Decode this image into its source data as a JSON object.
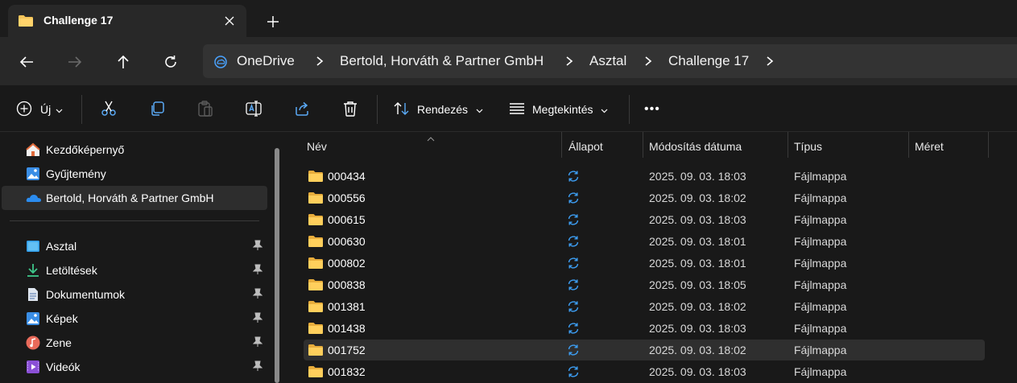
{
  "tab": {
    "title": "Challenge 17"
  },
  "breadcrumb": [
    "OneDrive",
    "Bertold, Horváth & Partner GmbH",
    "Asztal",
    "Challenge 17"
  ],
  "toolbar": {
    "new_label": "Új",
    "sort_label": "Rendezés",
    "view_label": "Megtekintés",
    "more_label": "•••"
  },
  "sidebar": {
    "top": [
      {
        "label": "Kezdőképernyő",
        "icon": "home-icon"
      },
      {
        "label": "Gyűjtemény",
        "icon": "gallery-icon"
      },
      {
        "label": "Bertold, Horváth & Partner GmbH",
        "icon": "onedrive-cloud-icon"
      }
    ],
    "pinned": [
      {
        "label": "Asztal",
        "icon": "desktop-icon"
      },
      {
        "label": "Letöltések",
        "icon": "download-icon"
      },
      {
        "label": "Dokumentumok",
        "icon": "document-icon"
      },
      {
        "label": "Képek",
        "icon": "pictures-icon"
      },
      {
        "label": "Zene",
        "icon": "music-icon"
      },
      {
        "label": "Videók",
        "icon": "video-icon"
      }
    ]
  },
  "columns": {
    "name": "Név",
    "status": "Állapot",
    "modified": "Módosítás dátuma",
    "type": "Típus",
    "size": "Méret"
  },
  "files": [
    {
      "name": "000434",
      "modified": "2025. 09. 03. 18:03",
      "type": "Fájlmappa"
    },
    {
      "name": "000556",
      "modified": "2025. 09. 03. 18:02",
      "type": "Fájlmappa"
    },
    {
      "name": "000615",
      "modified": "2025. 09. 03. 18:03",
      "type": "Fájlmappa"
    },
    {
      "name": "000630",
      "modified": "2025. 09. 03. 18:01",
      "type": "Fájlmappa"
    },
    {
      "name": "000802",
      "modified": "2025. 09. 03. 18:01",
      "type": "Fájlmappa"
    },
    {
      "name": "000838",
      "modified": "2025. 09. 03. 18:05",
      "type": "Fájlmappa"
    },
    {
      "name": "001381",
      "modified": "2025. 09. 03. 18:02",
      "type": "Fájlmappa"
    },
    {
      "name": "001438",
      "modified": "2025. 09. 03. 18:03",
      "type": "Fájlmappa"
    },
    {
      "name": "001752",
      "modified": "2025. 09. 03. 18:02",
      "type": "Fájlmappa",
      "selected": true
    },
    {
      "name": "001832",
      "modified": "2025. 09. 03. 18:03",
      "type": "Fájlmappa"
    }
  ],
  "colors": {
    "folder": "#f4c45a",
    "sync": "#3d9ff5",
    "accent": "#4aa3ff"
  }
}
